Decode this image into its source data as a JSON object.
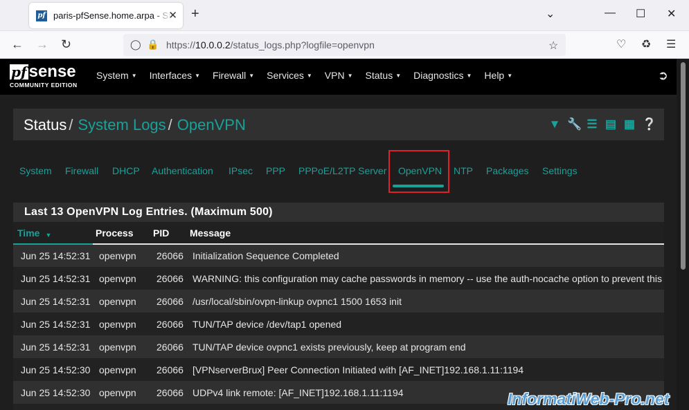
{
  "browser": {
    "tab_title": "paris-pfSense.home.arpa - Status: System Logs: OpenVPN",
    "favicon_text": "pf",
    "close_glyph": "✕",
    "new_tab_glyph": "+",
    "url_prefix": "https://",
    "url_host": "10.0.0.2",
    "url_path": "/status_logs.php?logfile=openvpn"
  },
  "nav": {
    "logo_pf": "pf",
    "logo_sense": "sense",
    "logo_sub": "COMMUNITY EDITION",
    "menu": [
      "System",
      "Interfaces",
      "Firewall",
      "Services",
      "VPN",
      "Status",
      "Diagnostics",
      "Help"
    ]
  },
  "breadcrumb": {
    "root": "Status",
    "sep": "/",
    "level1": "System Logs",
    "level2": "OpenVPN"
  },
  "header_icons": [
    "filter-icon",
    "wrench-icon",
    "sliders-icon",
    "bar-chart-icon",
    "list-icon",
    "help-icon"
  ],
  "tabs": [
    "System",
    "Firewall",
    "DHCP",
    "Authentication",
    "IPsec",
    "PPP",
    "PPPoE/L2TP Server",
    "OpenVPN",
    "NTP",
    "Packages",
    "Settings"
  ],
  "active_tab": "OpenVPN",
  "panel": {
    "title": "Last 13 OpenVPN Log Entries. (Maximum 500)",
    "columns": [
      "Time",
      "Process",
      "PID",
      "Message"
    ],
    "rows": [
      [
        "Jun 25 14:52:31",
        "openvpn",
        "26066",
        "Initialization Sequence Completed"
      ],
      [
        "Jun 25 14:52:31",
        "openvpn",
        "26066",
        "WARNING: this configuration may cache passwords in memory -- use the auth-nocache option to prevent this"
      ],
      [
        "Jun 25 14:52:31",
        "openvpn",
        "26066",
        "/usr/local/sbin/ovpn-linkup ovpnc1 1500 1653 init"
      ],
      [
        "Jun 25 14:52:31",
        "openvpn",
        "26066",
        "TUN/TAP device /dev/tap1 opened"
      ],
      [
        "Jun 25 14:52:31",
        "openvpn",
        "26066",
        "TUN/TAP device ovpnc1 exists previously, keep at program end"
      ],
      [
        "Jun 25 14:52:30",
        "openvpn",
        "26066",
        "[VPNserverBrux] Peer Connection Initiated with [AF_INET]192.168.1.11:1194"
      ],
      [
        "Jun 25 14:52:30",
        "openvpn",
        "26066",
        "UDPv4 link remote: [AF_INET]192.168.1.11:1194"
      ],
      [
        "Jun 25 14:52:30",
        "openvpn",
        "26066",
        ""
      ]
    ]
  },
  "watermark": "InformatiWeb-Pro.net",
  "colors": {
    "accent": "#17a29a",
    "highlight_box": "#e0202a",
    "nav_bg": "#000000",
    "page_bg": "#1e1e1e"
  }
}
